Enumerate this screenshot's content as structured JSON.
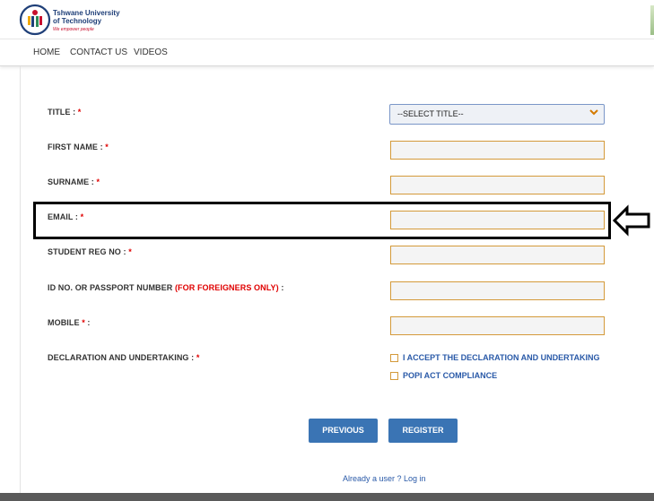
{
  "header": {
    "logo_line1": "Tshwane University",
    "logo_line2": "of Technology",
    "logo_tagline": "We empower people"
  },
  "nav": {
    "home": "HOME",
    "contact": "CONTACT US",
    "videos": "VIDEOS"
  },
  "form": {
    "title_label": "TITLE : ",
    "title_select_value": "--SELECT TITLE--",
    "first_name_label": "FIRST NAME : ",
    "surname_label": "SURNAME : ",
    "email_label": "EMAIL : ",
    "student_reg_label": "STUDENT REG NO : ",
    "id_label": "ID NO. OR PASSPORT NUMBER ",
    "id_foreign_note": "(FOR FOREIGNERS ONLY)",
    "id_label_suffix": " :",
    "mobile_label": "MOBILE ",
    "mobile_suffix": " :",
    "declaration_label": "DECLARATION AND UNDERTAKING : ",
    "required_mark": "*",
    "accept_declaration": "I ACCEPT THE DECLARATION AND UNDERTAKING",
    "popi_compliance": "POPI ACT COMPLIANCE"
  },
  "buttons": {
    "previous": "PREVIOUS",
    "register": "REGISTER"
  },
  "login_link": "Already a user ? Log in",
  "colors": {
    "accent_blue": "#3a74b4",
    "required_red": "#e00000",
    "field_border": "#d49a3a",
    "link_blue": "#2a5aa8"
  }
}
